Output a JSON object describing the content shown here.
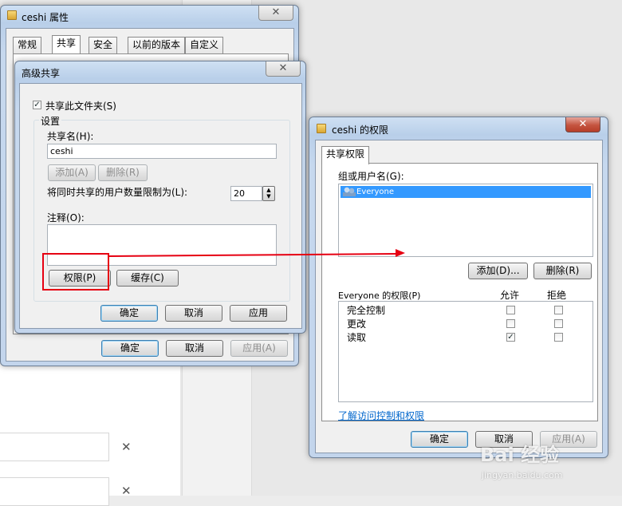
{
  "props": {
    "title": "ceshi 属性",
    "tabs": [
      "常规",
      "共享",
      "安全",
      "以前的版本",
      "自定义"
    ],
    "ok": "确定",
    "cancel": "取消",
    "apply": "应用(A)"
  },
  "advanced": {
    "title": "高级共享",
    "share_checkbox": "共享此文件夹(S)",
    "settings_label": "设置",
    "share_name_label": "共享名(H):",
    "share_name_value": "ceshi",
    "add": "添加(A)",
    "remove": "删除(R)",
    "limit_label": "将同时共享的用户数量限制为(L):",
    "limit_value": "20",
    "comment_label": "注释(O):",
    "permissions": "权限(P)",
    "caching": "缓存(C)",
    "ok": "确定",
    "cancel": "取消",
    "apply": "应用"
  },
  "perms": {
    "title": "ceshi 的权限",
    "tab": "共享权限",
    "group_label": "组或用户名(G):",
    "users": [
      "Everyone"
    ],
    "add": "添加(D)...",
    "remove": "删除(R)",
    "perm_label": "Everyone 的权限(P)",
    "allow": "允许",
    "deny": "拒绝",
    "rows": [
      {
        "name": "完全控制",
        "allow": false,
        "deny": false
      },
      {
        "name": "更改",
        "allow": false,
        "deny": false
      },
      {
        "name": "读取",
        "allow": true,
        "deny": false
      }
    ],
    "link": "了解访问控制和权限",
    "ok": "确定",
    "cancel": "取消",
    "apply": "应用(A)"
  },
  "watermark": {
    "logo": "Bai 经验",
    "url": "jingyan.baidu.com"
  },
  "colors": {
    "highlight": "#e60012",
    "selection": "#3399ff"
  }
}
